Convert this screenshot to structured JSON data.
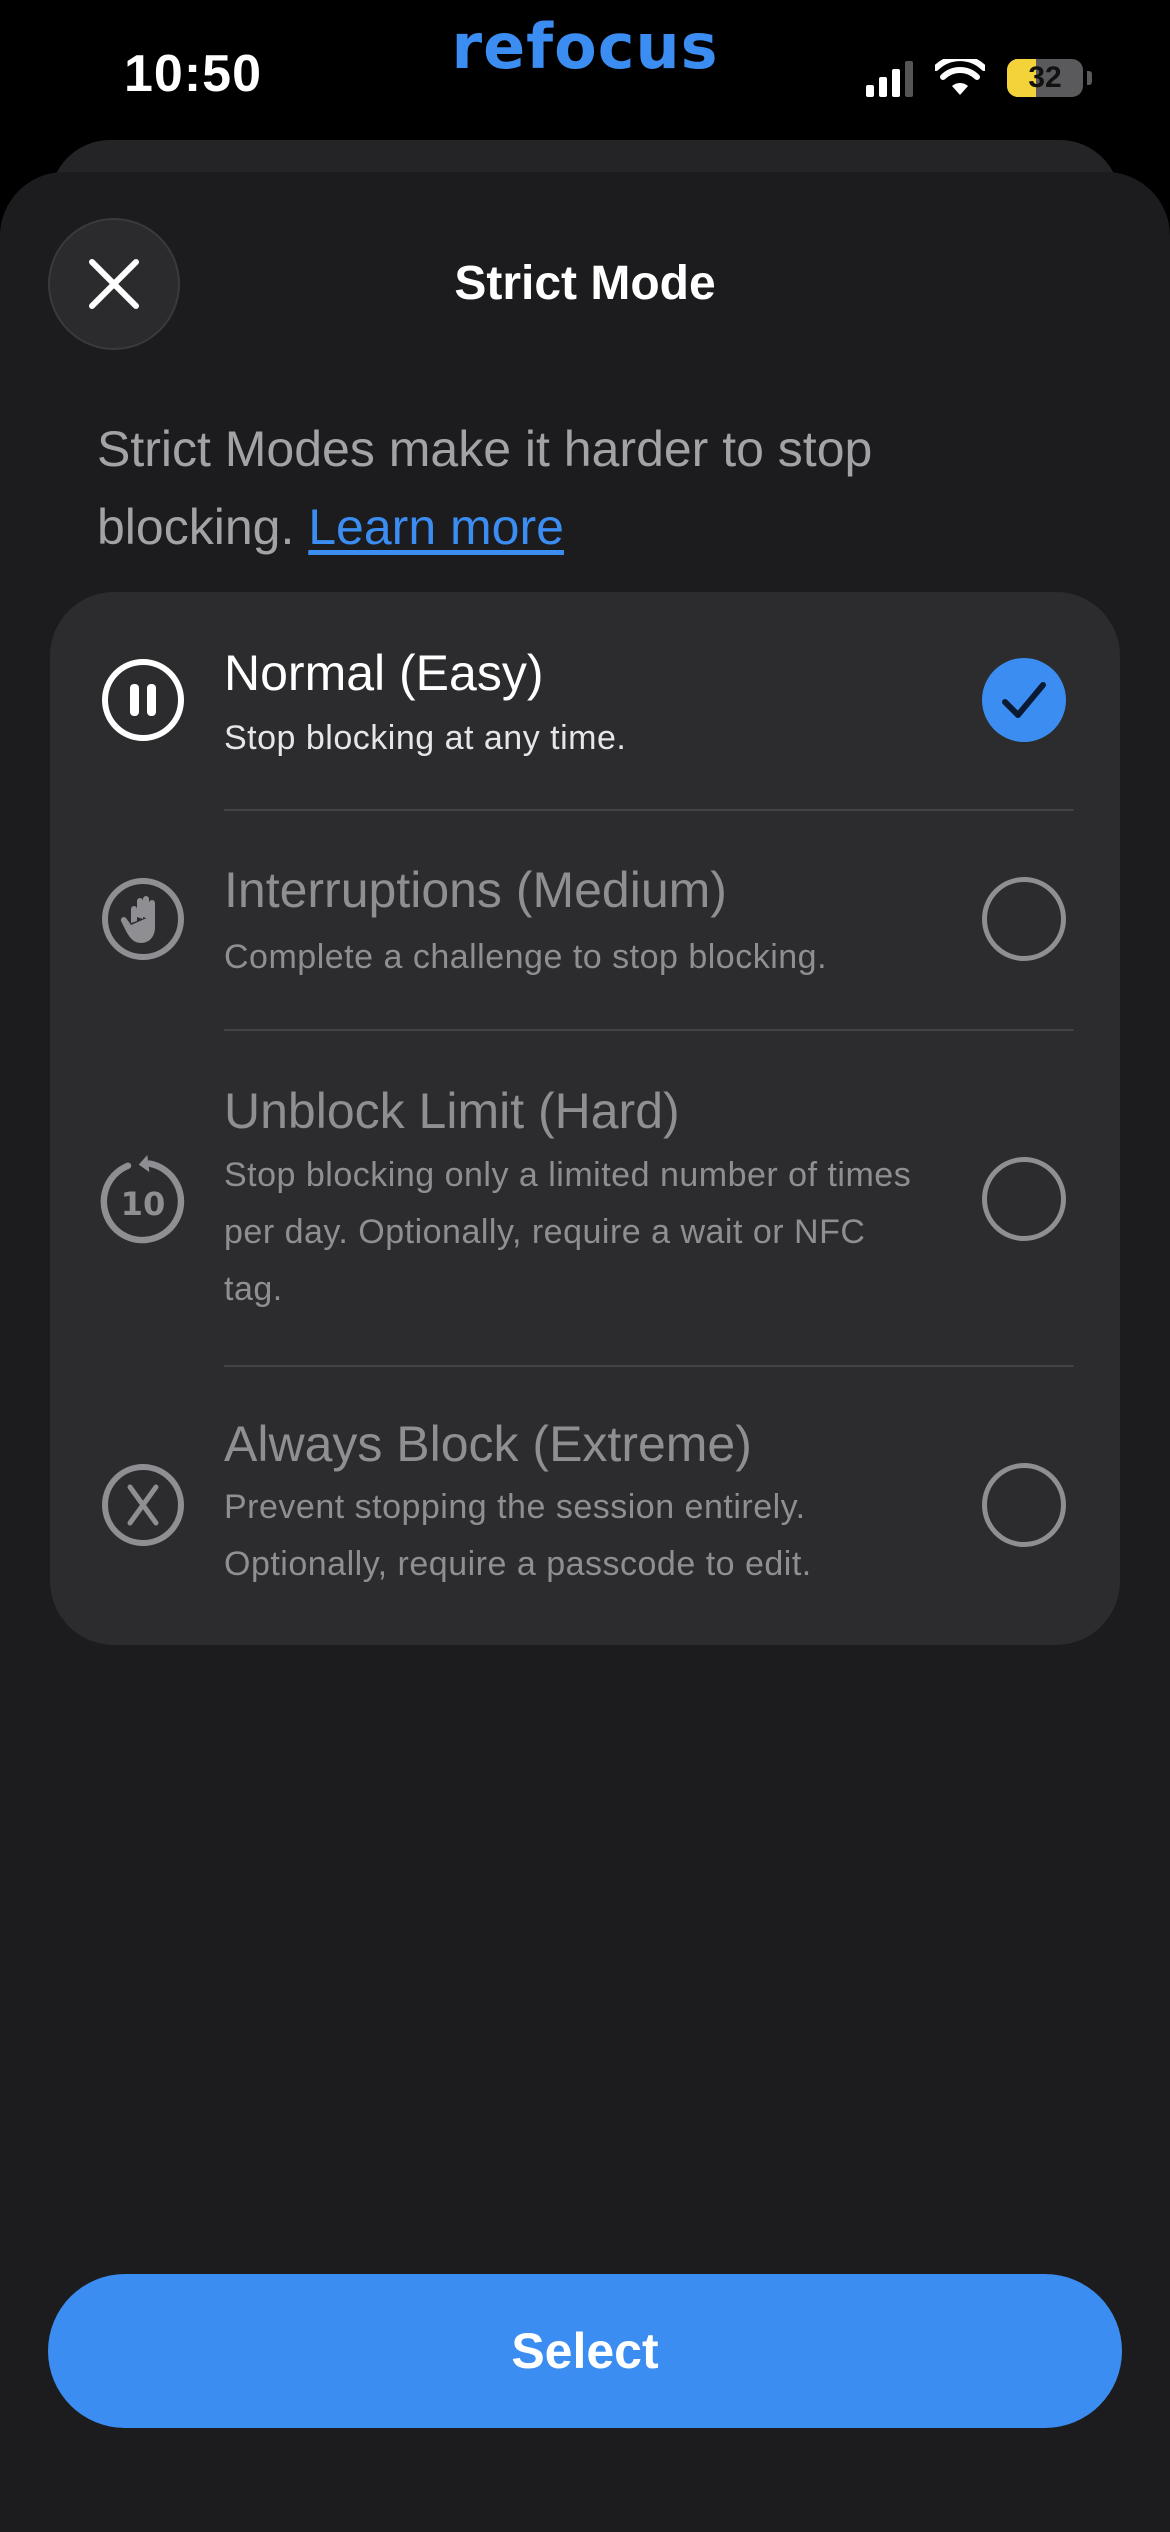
{
  "status_bar": {
    "time": "10:50",
    "app_name": "refocus",
    "battery_percent": "32",
    "battery_level": 0.32,
    "battery_color": "#f4d23a"
  },
  "sheet": {
    "title": "Strict Mode",
    "close_icon": "close-icon"
  },
  "intro": {
    "text": "Strict Modes make it harder to stop blocking.",
    "link": "Learn more"
  },
  "options": [
    {
      "title": "Normal (Easy)",
      "description": "Stop blocking at any time.",
      "icon": "pause-icon",
      "selected": true
    },
    {
      "title": "Interruptions (Medium)",
      "description": "Complete a challenge to stop blocking.",
      "icon": "hand-icon",
      "selected": false
    },
    {
      "title": "Unblock Limit (Hard)",
      "description": "Stop blocking only a limited number of times per day. Optionally, require a wait or NFC tag.",
      "icon": "replay-10-icon",
      "icon_text": "10",
      "selected": false
    },
    {
      "title": "Always Block (Extreme)",
      "description": "Prevent stopping the session entirely. Optionally, require a passcode to edit.",
      "icon": "x-circle-icon",
      "selected": false
    }
  ],
  "actions": {
    "select_label": "Select"
  },
  "colors": {
    "accent": "#3b8df2",
    "background": "#1c1c1e",
    "card": "#2c2c2e",
    "muted_text": "#8e8e93"
  }
}
